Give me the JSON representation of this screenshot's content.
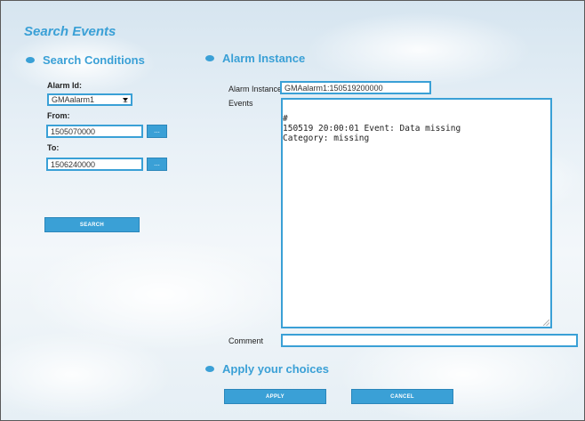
{
  "page_title": "Search Events",
  "search_conditions": {
    "title": "Search Conditions",
    "alarm_id_label": "Alarm Id:",
    "alarm_id_value": "GMAalarm1",
    "from_label": "From:",
    "from_value": "1505070000",
    "to_label": "To:",
    "to_value": "1506240000",
    "picker_label": "...",
    "search_label": "SEARCH"
  },
  "alarm_instance": {
    "title": "Alarm Instance",
    "instance_label": "Alarm Instance",
    "instance_value": "GMAalarm1:150519200000",
    "events_label": "Events",
    "events_lines": [
      "#",
      "150519 20:00:01 Event: Data missing",
      "Category: missing"
    ],
    "comment_label": "Comment",
    "comment_value": ""
  },
  "apply": {
    "title": "Apply your choices",
    "apply_label": "APPLY",
    "cancel_label": "CANCEL"
  },
  "colors": {
    "accent": "#3aa0d6",
    "button_border": "#2a86ba"
  }
}
